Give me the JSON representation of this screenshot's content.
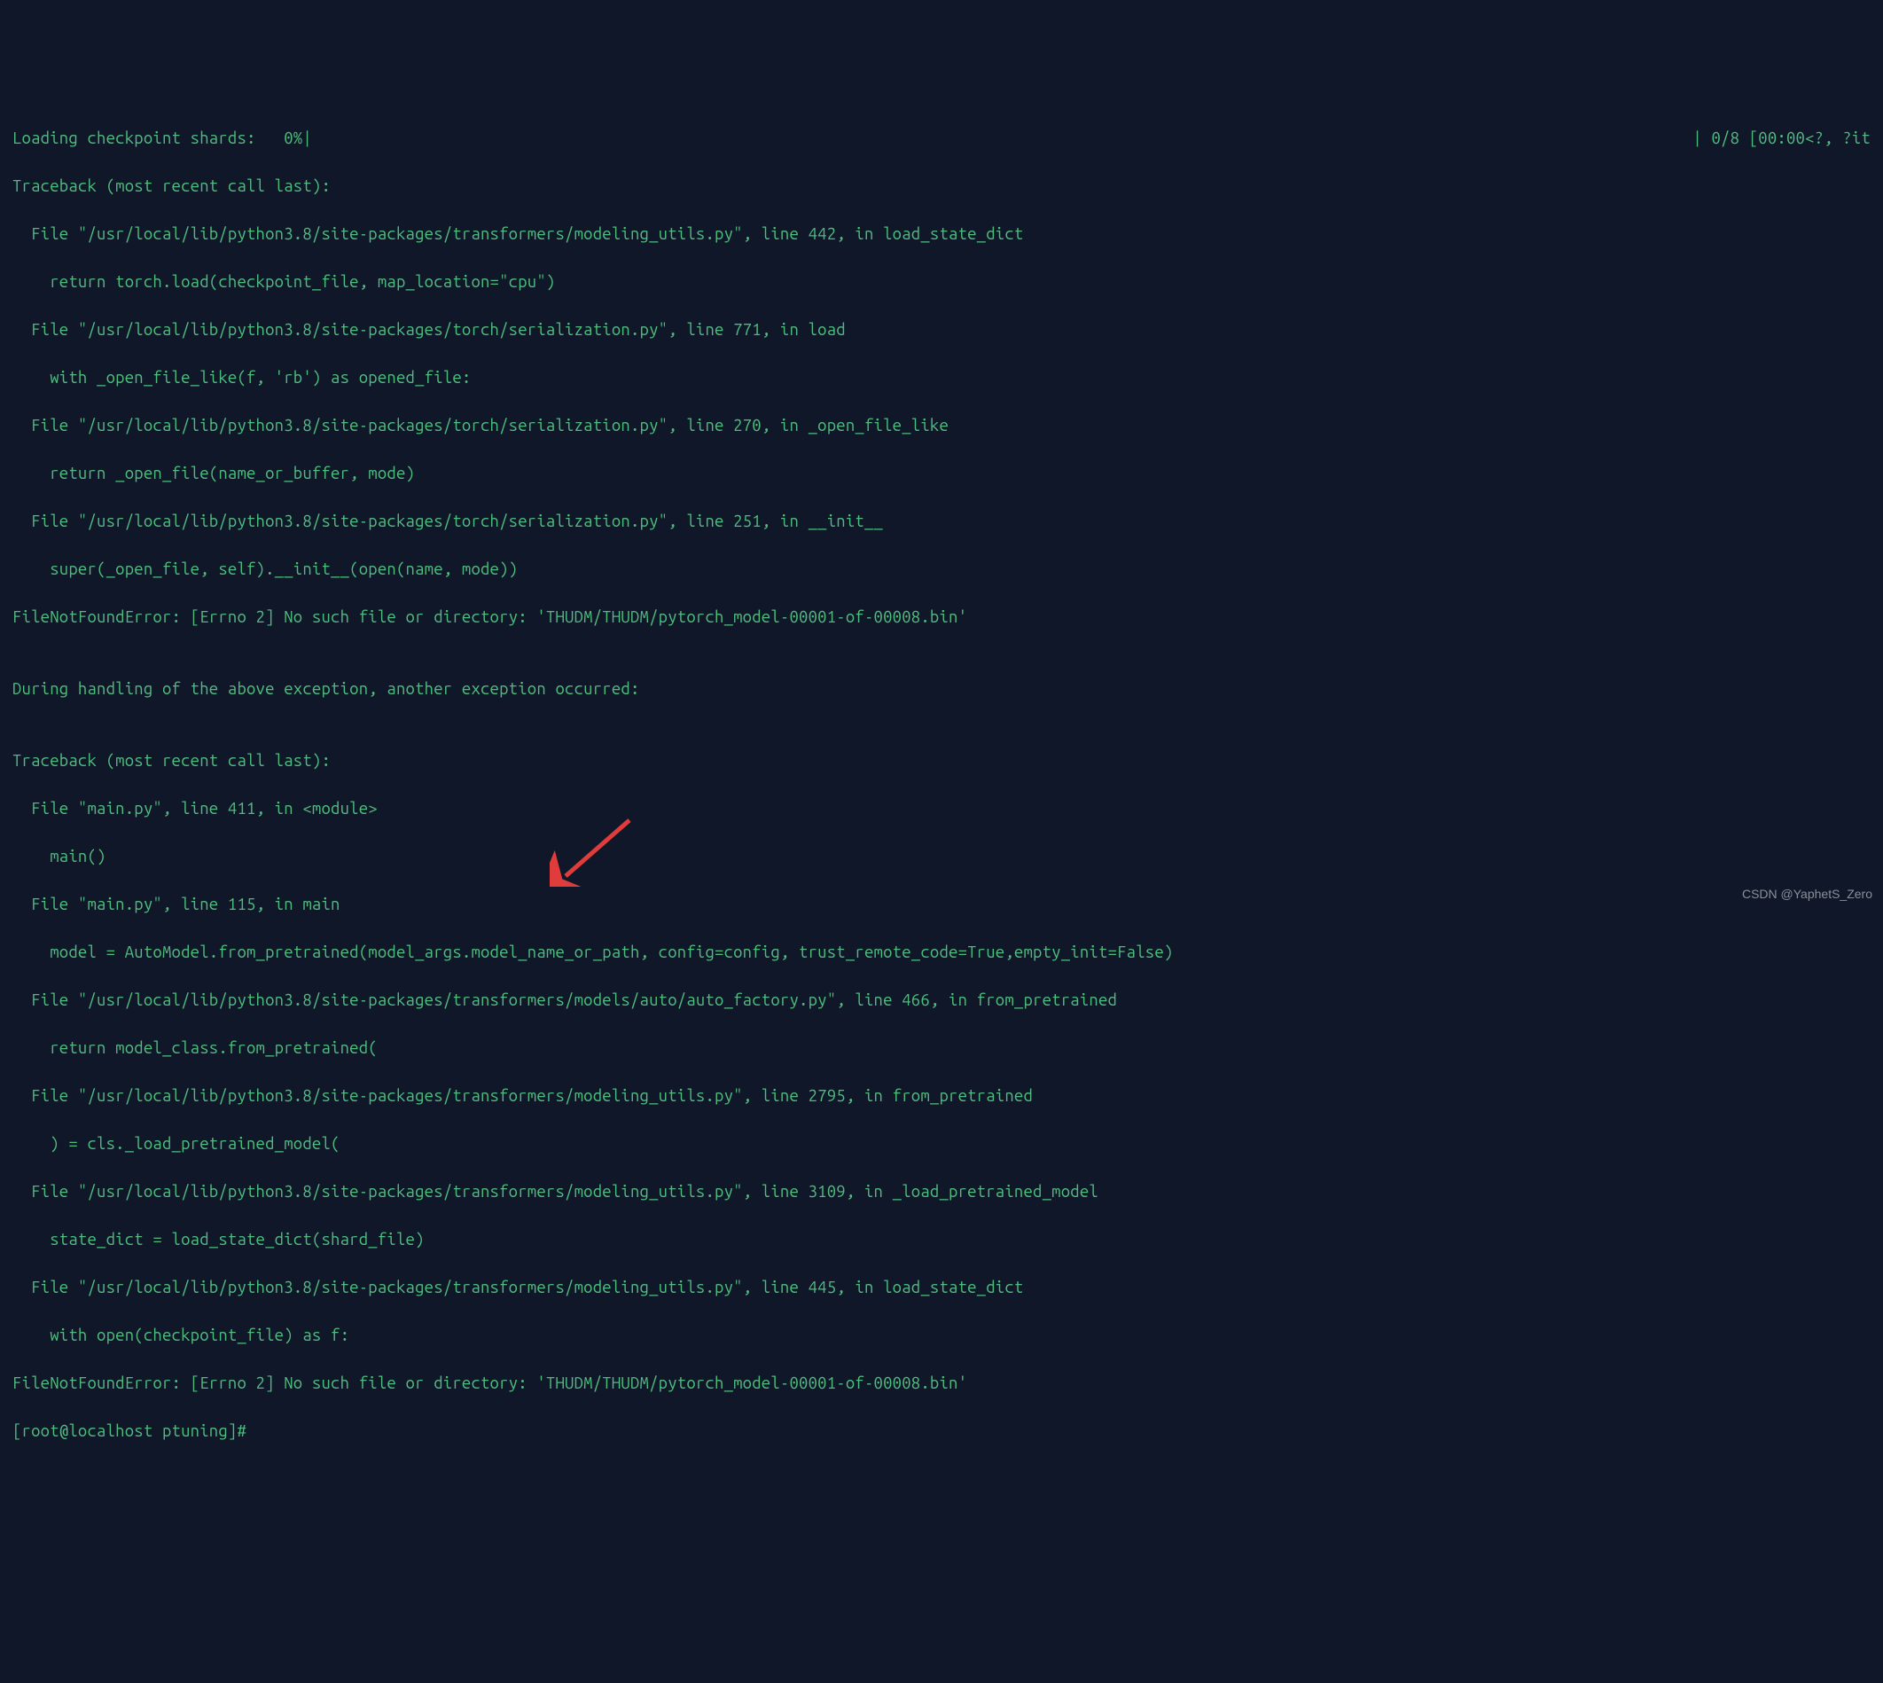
{
  "terminal": {
    "progress_left": "Loading checkpoint shards:   0%|",
    "progress_right": "| 0/8 [00:00<?, ?it",
    "lines": [
      "Traceback (most recent call last):",
      "  File \"/usr/local/lib/python3.8/site-packages/transformers/modeling_utils.py\", line 442, in load_state_dict",
      "    return torch.load(checkpoint_file, map_location=\"cpu\")",
      "  File \"/usr/local/lib/python3.8/site-packages/torch/serialization.py\", line 771, in load",
      "    with _open_file_like(f, 'rb') as opened_file:",
      "  File \"/usr/local/lib/python3.8/site-packages/torch/serialization.py\", line 270, in _open_file_like",
      "    return _open_file(name_or_buffer, mode)",
      "  File \"/usr/local/lib/python3.8/site-packages/torch/serialization.py\", line 251, in __init__",
      "    super(_open_file, self).__init__(open(name, mode))",
      "FileNotFoundError: [Errno 2] No such file or directory: 'THUDM/THUDM/pytorch_model-00001-of-00008.bin'",
      "",
      "During handling of the above exception, another exception occurred:",
      "",
      "Traceback (most recent call last):",
      "  File \"main.py\", line 411, in <module>",
      "    main()",
      "  File \"main.py\", line 115, in main",
      "    model = AutoModel.from_pretrained(model_args.model_name_or_path, config=config, trust_remote_code=True,empty_init=False)",
      "  File \"/usr/local/lib/python3.8/site-packages/transformers/models/auto/auto_factory.py\", line 466, in from_pretrained",
      "    return model_class.from_pretrained(",
      "  File \"/usr/local/lib/python3.8/site-packages/transformers/modeling_utils.py\", line 2795, in from_pretrained",
      "    ) = cls._load_pretrained_model(",
      "  File \"/usr/local/lib/python3.8/site-packages/transformers/modeling_utils.py\", line 3109, in _load_pretrained_model",
      "    state_dict = load_state_dict(shard_file)",
      "  File \"/usr/local/lib/python3.8/site-packages/transformers/modeling_utils.py\", line 445, in load_state_dict",
      "    with open(checkpoint_file) as f:",
      "FileNotFoundError: [Errno 2] No such file or directory: 'THUDM/THUDM/pytorch_model-00001-of-00008.bin'",
      "[root@localhost ptuning]#"
    ]
  },
  "watermark": "CSDN @YaphetS_Zero"
}
